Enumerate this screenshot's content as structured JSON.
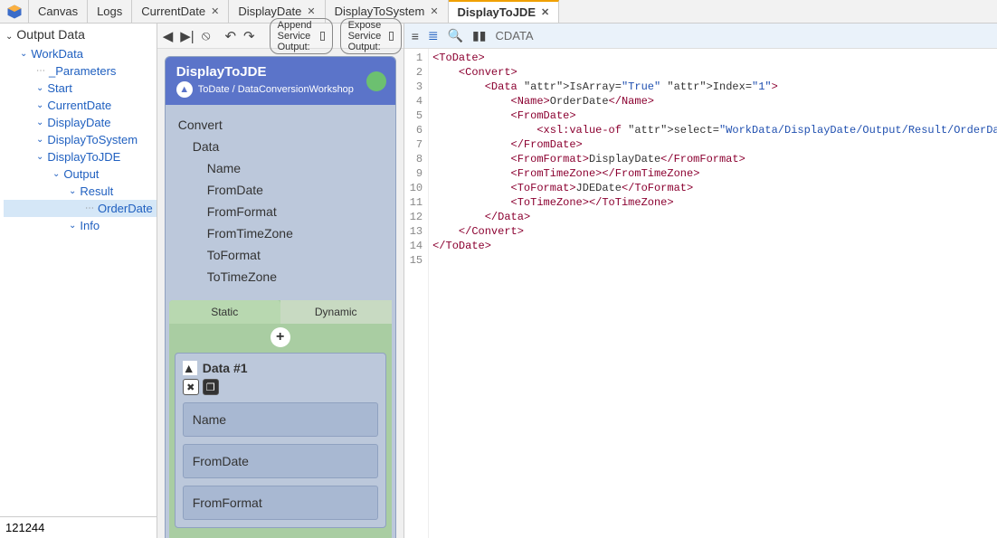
{
  "tabs": [
    "Canvas",
    "Logs",
    "CurrentDate",
    "DisplayDate",
    "DisplayToSystem",
    "DisplayToJDE"
  ],
  "panel_title": "Output Data",
  "tree": {
    "root": "WorkData",
    "n1": "_Parameters",
    "n2": "Start",
    "n3": "CurrentDate",
    "n4": "DisplayDate",
    "n5": "DisplayToSystem",
    "n6": "DisplayToJDE",
    "n7": "Output",
    "n8": "Result",
    "n9": "OrderDate",
    "n10": "Info"
  },
  "bottom_value": "121244",
  "toolbar": {
    "append": "Append Service Output:",
    "expose": "Expose Service Output:"
  },
  "card": {
    "title": "DisplayToJDE",
    "subtitle": "ToDate / DataConversionWorkshop",
    "props": [
      "Convert",
      "Data",
      "Name",
      "FromDate",
      "FromFormat",
      "FromTimeZone",
      "ToFormat",
      "ToTimeZone"
    ],
    "tabs": [
      "Static",
      "Dynamic"
    ],
    "block_title": "Data #1",
    "fields": [
      "Name",
      "FromDate",
      "FromFormat"
    ]
  },
  "right_label": "CDATA",
  "code_lines": [
    "<ToDate>",
    "    <Convert>",
    "        <Data IsArray=\"True\" Index=\"1\">",
    "            <Name>OrderDate</Name>",
    "            <FromDate>",
    "                <xsl:value-of select=\"WorkData/DisplayDate/Output/Result/OrderDate\"/>",
    "            </FromDate>",
    "            <FromFormat>DisplayDate</FromFormat>",
    "            <FromTimeZone></FromTimeZone>",
    "            <ToFormat>JDEDate</ToFormat>",
    "            <ToTimeZone></ToTimeZone>",
    "        </Data>",
    "    </Convert>",
    "</ToDate>",
    ""
  ]
}
